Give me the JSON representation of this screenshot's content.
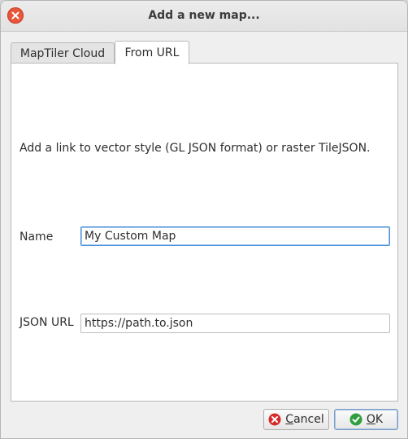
{
  "window": {
    "title": "Add a new map..."
  },
  "tabs": [
    {
      "label": "MapTiler Cloud",
      "active": false
    },
    {
      "label": "From URL",
      "active": true
    }
  ],
  "panel": {
    "description": "Add a link to vector style (GL JSON format) or raster TileJSON.",
    "name_field": {
      "label": "Name",
      "value": "My Custom Map"
    },
    "url_field": {
      "label": "JSON URL",
      "value": "https://path.to.json"
    }
  },
  "buttons": {
    "cancel": {
      "label_first": "C",
      "label_rest": "ancel",
      "icon": "cancel-icon"
    },
    "ok": {
      "label_first": "O",
      "label_rest": "K",
      "icon": "check-icon"
    }
  },
  "colors": {
    "close": "#e8553a",
    "cancel_icon": "#d62b2b",
    "ok_icon": "#2e9e3e",
    "focus": "#4a90d9"
  }
}
